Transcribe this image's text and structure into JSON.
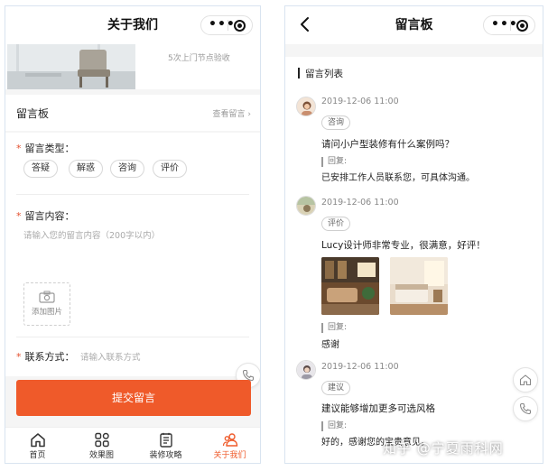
{
  "left_screen": {
    "nav_title": "关于我们",
    "banner_note": "5次上门节点验收",
    "board_title": "留言板",
    "view_link": "查看留言",
    "type_label": "留言类型：",
    "type_tags": [
      "答疑",
      "解惑",
      "咨询",
      "评价"
    ],
    "content_label": "留言内容：",
    "content_placeholder": "请输入您的留言内容（200字以内）",
    "upload_label": "添加图片",
    "contact_label": "联系方式：",
    "contact_placeholder": "请输入联系方式",
    "submit_label": "提交留言",
    "tabs": [
      {
        "label": "首页",
        "icon": "home-icon"
      },
      {
        "label": "效果图",
        "icon": "grid-icon"
      },
      {
        "label": "装修攻略",
        "icon": "document-icon"
      },
      {
        "label": "关于我们",
        "icon": "people-icon"
      }
    ],
    "accent_color": "#ef5a2a"
  },
  "right_screen": {
    "nav_title": "留言板",
    "list_title": "留言列表",
    "reply_label": "回复:",
    "messages": [
      {
        "date": "2019-12-06 11:00",
        "tag": "咨询",
        "text": "请问小户型装修有什么案例吗？",
        "reply": "已安排工作人员联系您，可具体沟通。"
      },
      {
        "date": "2019-12-06 11:00",
        "tag": "评价",
        "text": "Lucy设计师非常专业，很满意，好评！",
        "reply": "感谢"
      },
      {
        "date": "2019-12-06 11:00",
        "tag": "建议",
        "text": "建议能够增加更多可选风格",
        "reply": "好的，感谢您的宝贵意见。"
      }
    ]
  },
  "watermark": "知乎 @宁夏雨科网"
}
